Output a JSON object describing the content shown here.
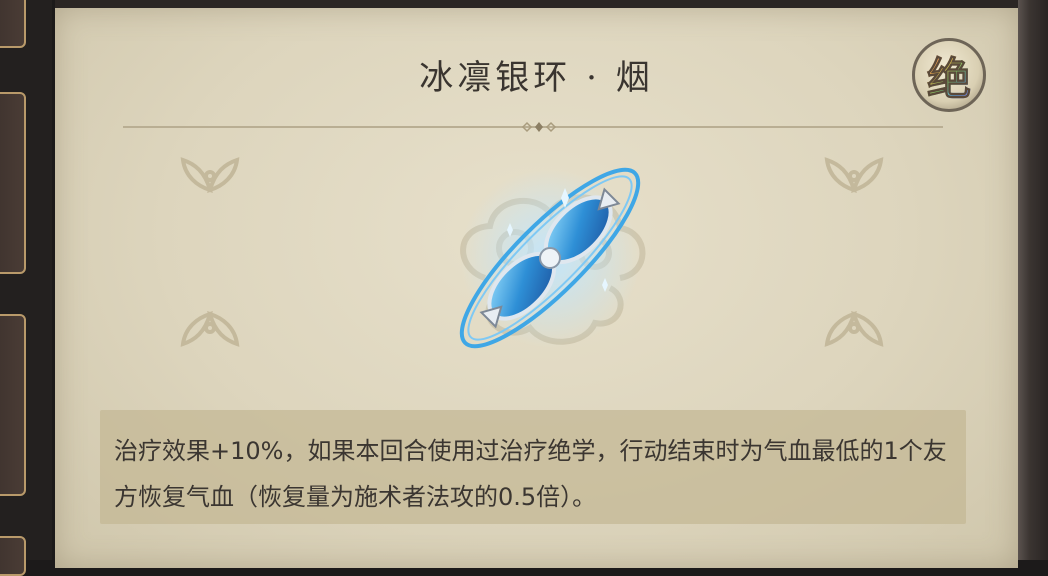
{
  "item": {
    "name": "冰凛银环 · 烟",
    "rarity_glyph": "绝",
    "description": "治疗效果+10%，如果本回合使用过治疗绝学，行动结束时为气血最低的1个友方恢复气血（恢复量为施术者法攻的0.5倍）。"
  },
  "icons": {
    "item": "blue-crystal-ring-icon",
    "ornaments": "leaf-flourish-icon"
  },
  "colors": {
    "parchment": "#ddd5bd",
    "title_text": "#3a3530",
    "body_text": "#3b3631",
    "crystal_blue": "#3fa7e6"
  }
}
